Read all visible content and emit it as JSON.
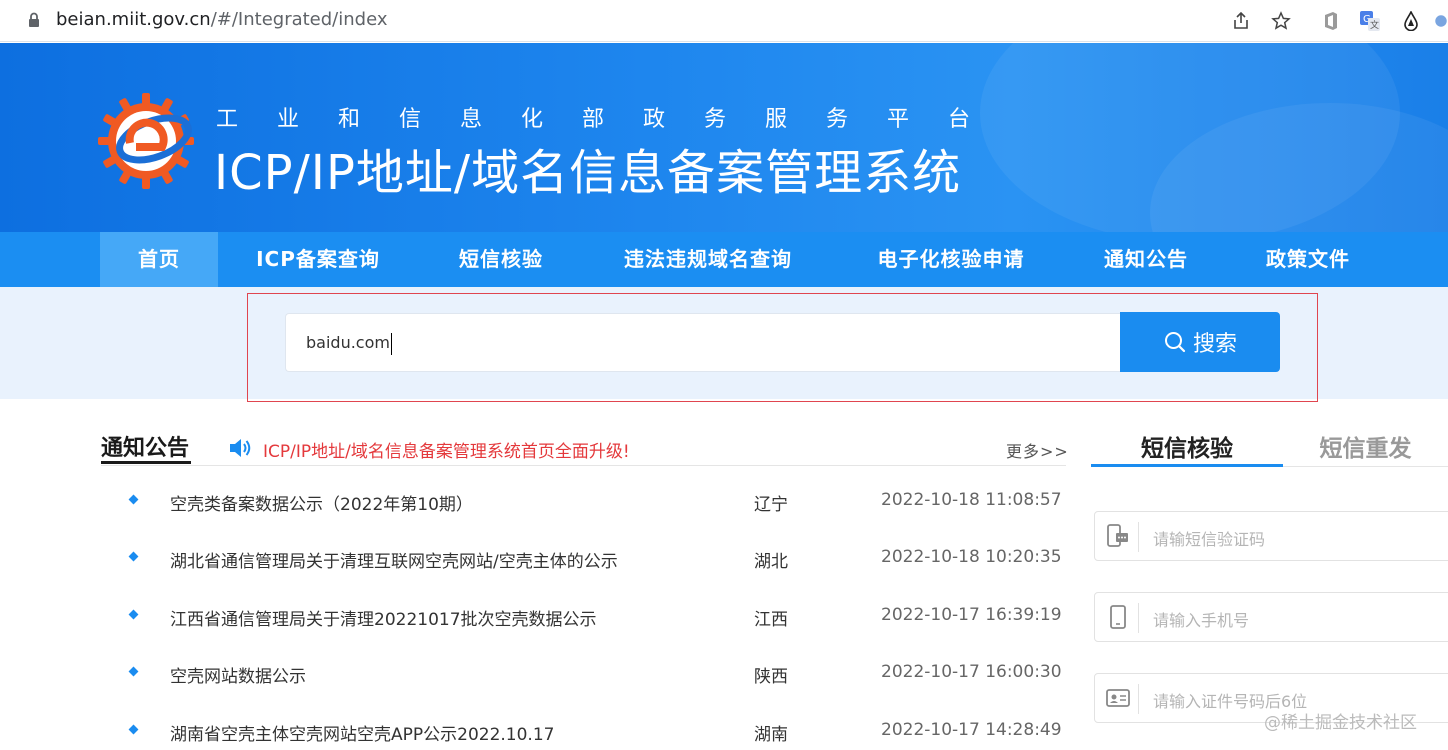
{
  "browser": {
    "url_host": "beian.miit.gov.cn",
    "url_path": "/#/Integrated/index",
    "icons": [
      "lock-icon",
      "share-icon",
      "star-icon",
      "office-extension-icon",
      "translate-extension-icon",
      "drop-extension-icon",
      "profile-icon"
    ]
  },
  "header": {
    "subtitle": "工业和信息化部政务服务平台",
    "title": "ICP/IP地址/域名信息备案管理系统"
  },
  "nav": {
    "items": [
      {
        "label": "首页",
        "active": true
      },
      {
        "label": "ICP备案查询"
      },
      {
        "label": "短信核验"
      },
      {
        "label": "违法违规域名查询"
      },
      {
        "label": "电子化核验申请"
      },
      {
        "label": "通知公告"
      },
      {
        "label": "政策文件"
      }
    ]
  },
  "search": {
    "value": "baidu.com",
    "button_label": "搜索"
  },
  "notices": {
    "title": "通知公告",
    "headline": "ICP/IP地址/域名信息备案管理系统首页全面升级!",
    "more_label": "更多>>",
    "items": [
      {
        "title": "空壳类备案数据公示（2022年第10期）",
        "province": "辽宁",
        "time": "2022-10-18 11:08:57"
      },
      {
        "title": "湖北省通信管理局关于清理互联网空壳网站/空壳主体的公示",
        "province": "湖北",
        "time": "2022-10-18 10:20:35"
      },
      {
        "title": "江西省通信管理局关于清理20221017批次空壳数据公示",
        "province": "江西",
        "time": "2022-10-17 16:39:19"
      },
      {
        "title": "空壳网站数据公示",
        "province": "陕西",
        "time": "2022-10-17 16:00:30"
      },
      {
        "title": "湖南省空壳主体空壳网站空壳APP公示2022.10.17",
        "province": "湖南",
        "time": "2022-10-17 14:28:49"
      }
    ]
  },
  "sms": {
    "tab_verify": "短信核验",
    "tab_resend": "短信重发",
    "fields": [
      {
        "placeholder": "请输短信验证码",
        "icon": "sms-code-icon"
      },
      {
        "placeholder": "请输入手机号",
        "icon": "phone-icon"
      },
      {
        "placeholder": "请输入证件号码后6位",
        "icon": "id-card-icon"
      }
    ]
  },
  "watermark": "@稀土掘金技术社区",
  "colors": {
    "primary": "#1a8cf0",
    "nav_bg": "#1b8ef2",
    "nav_active": "#45a8f7",
    "headline_red": "#e4393c",
    "highlight_box": "#e0454f"
  }
}
